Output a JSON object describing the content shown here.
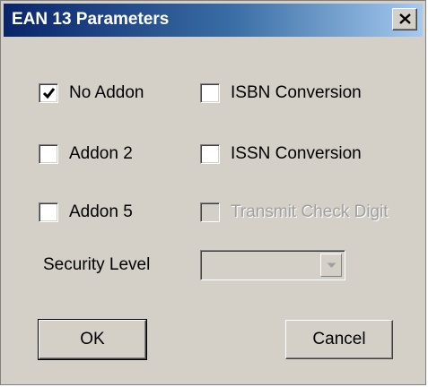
{
  "window": {
    "title": "EAN 13 Parameters"
  },
  "checkboxes": [
    {
      "label": "No Addon",
      "checked": true,
      "enabled": true
    },
    {
      "label": "ISBN Conversion",
      "checked": false,
      "enabled": true
    },
    {
      "label": "Addon 2",
      "checked": false,
      "enabled": true
    },
    {
      "label": "ISSN Conversion",
      "checked": false,
      "enabled": true
    },
    {
      "label": "Addon 5",
      "checked": false,
      "enabled": true
    },
    {
      "label": "Transmit Check Digit",
      "checked": false,
      "enabled": false
    }
  ],
  "security": {
    "label": "Security Level",
    "value": ""
  },
  "buttons": {
    "ok": "OK",
    "cancel": "Cancel"
  },
  "icons": {
    "close": "close-icon",
    "check": "check-icon",
    "dropdown": "chevron-down-icon"
  },
  "colors": {
    "title_bar_start": "#0a246a",
    "title_bar_end": "#a6caf0",
    "dialog_bg": "#d4d0c8",
    "disabled_text": "#a0a0a0"
  }
}
